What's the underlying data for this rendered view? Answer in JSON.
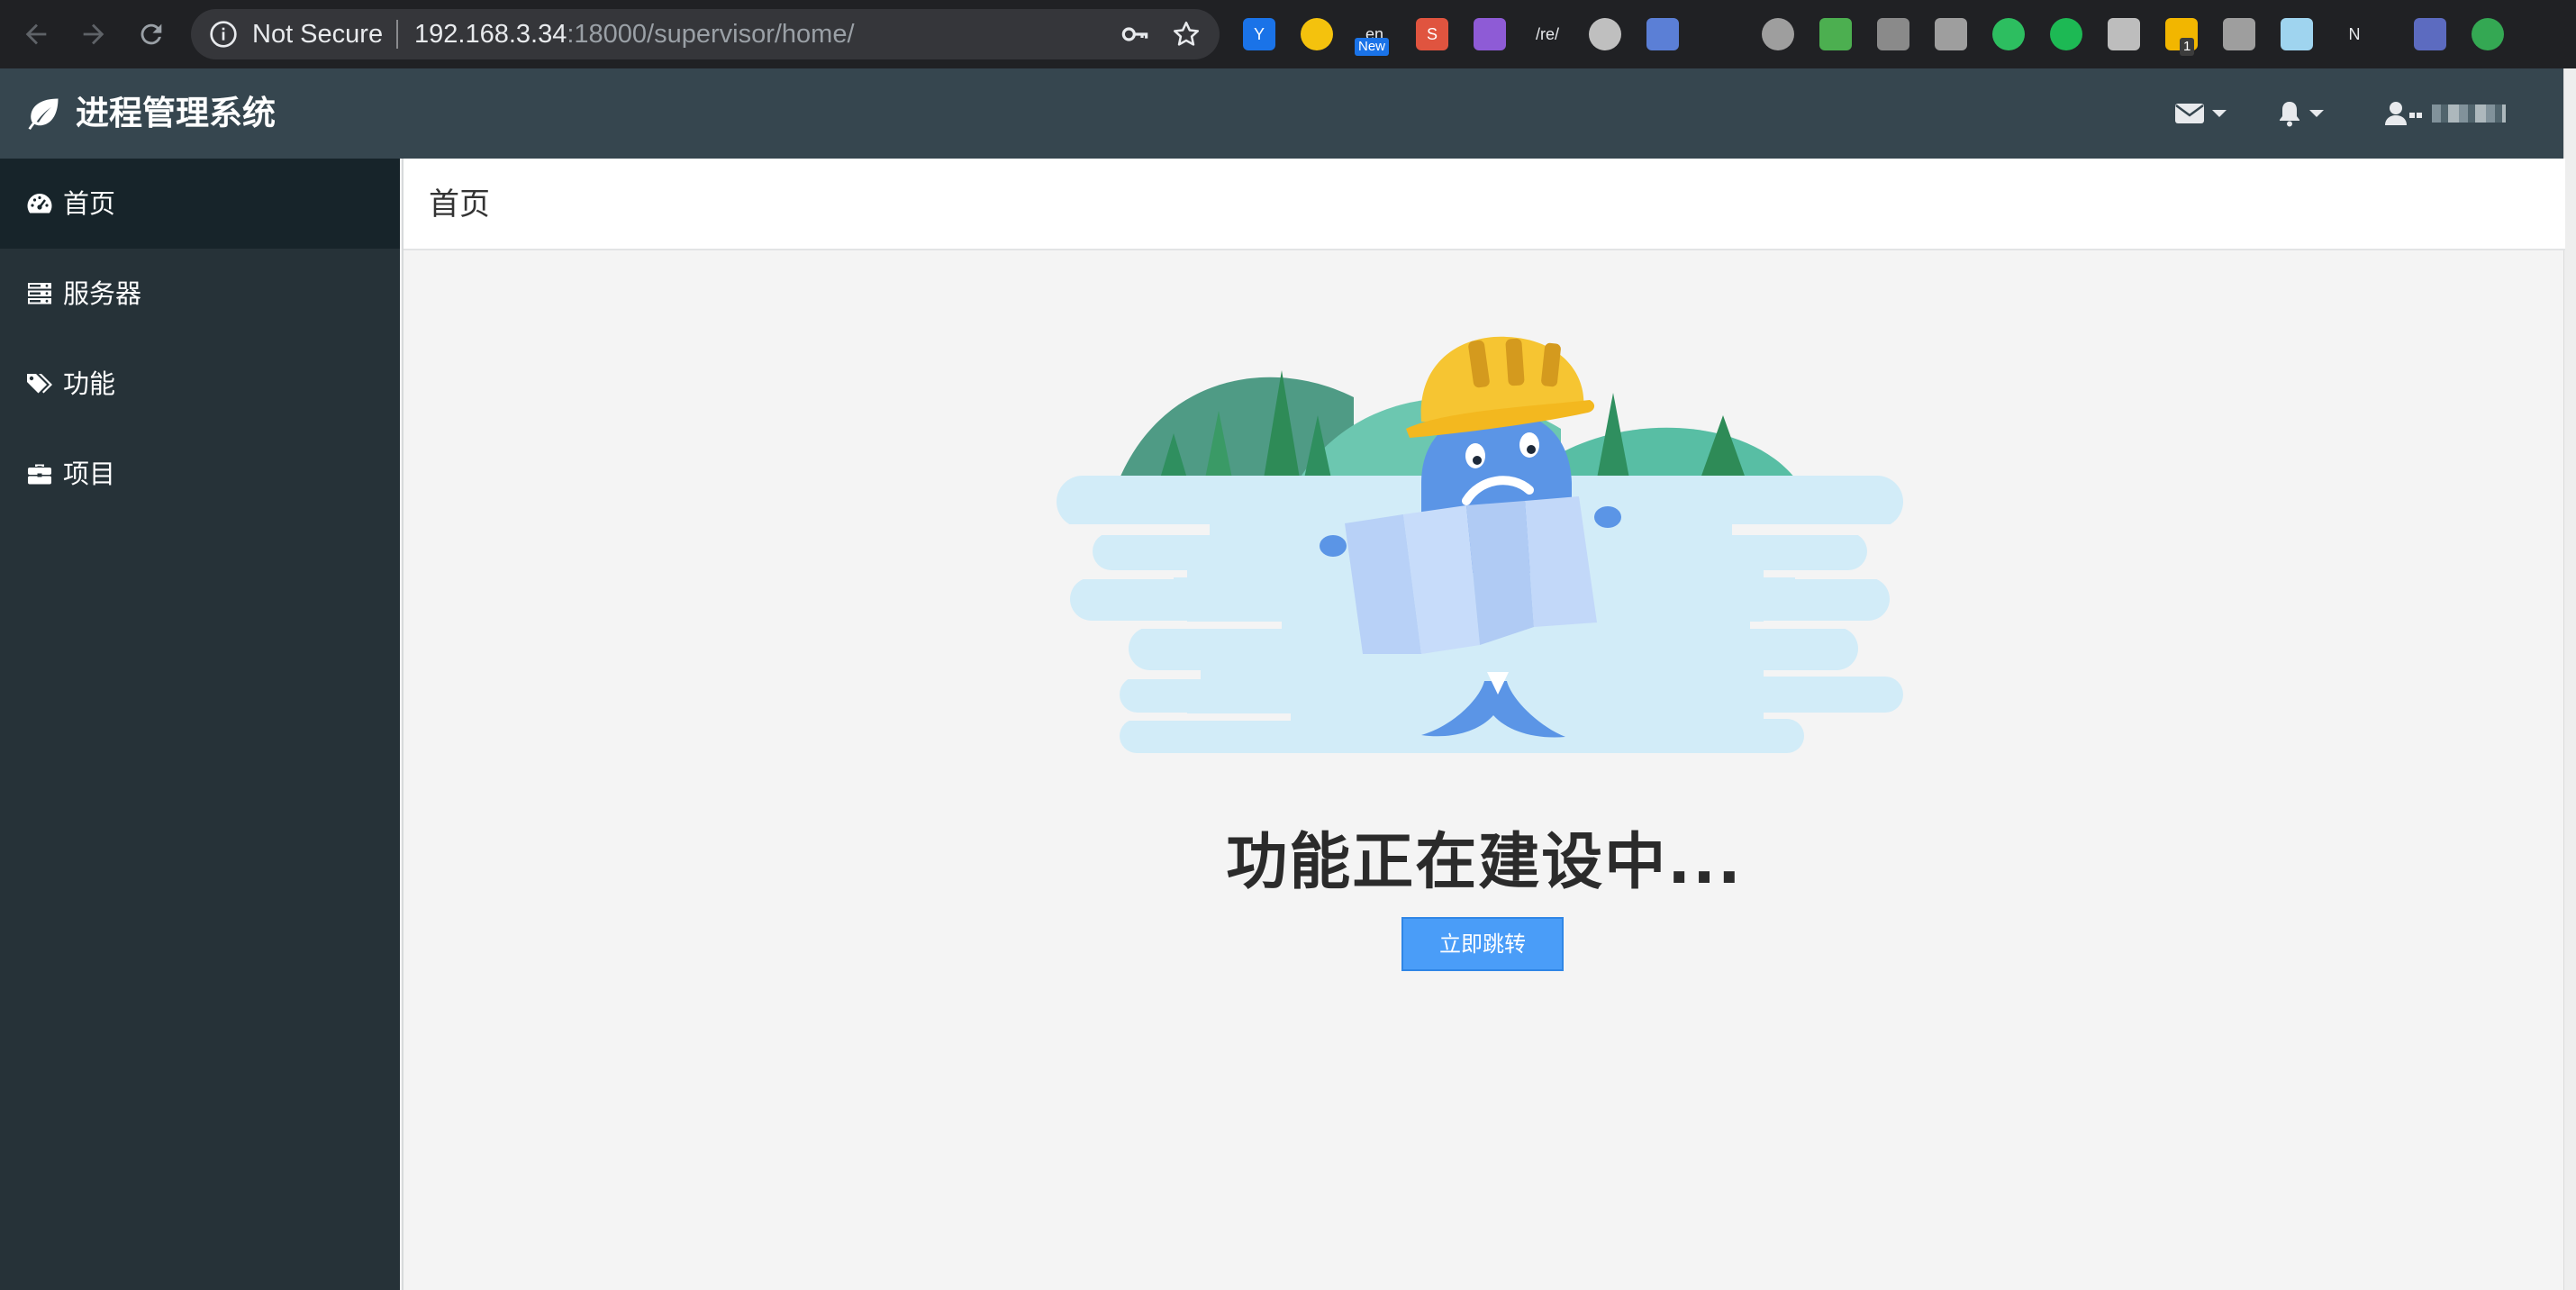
{
  "browser": {
    "security_label": "Not Secure",
    "url_host": "192.168.3.34",
    "url_path": ":18000/supervisor/home/",
    "extensions": [
      {
        "name": "y-extension-icon",
        "color": "#1a73e8",
        "glyph": "Y"
      },
      {
        "name": "smiley-extension-icon",
        "color": "#f4c20d",
        "glyph": ""
      },
      {
        "name": "translate-extension-icon",
        "color": "#ffffff",
        "glyph": "en",
        "badge": "New"
      },
      {
        "name": "s-extension-icon",
        "color": "#e0543f",
        "glyph": "S"
      },
      {
        "name": "grid-extension-icon",
        "color": "#8e5bd6",
        "glyph": ""
      },
      {
        "name": "regex-extension-icon",
        "color": "#ffffff",
        "glyph": "/re/"
      },
      {
        "name": "circle-extension-icon",
        "color": "#bfbfbf",
        "glyph": ""
      },
      {
        "name": "window-extension-icon",
        "color": "#5b7fd6",
        "glyph": ""
      },
      {
        "name": "ski-extension-icon",
        "color": "#ffffff",
        "glyph": ""
      },
      {
        "name": "ring-extension-icon",
        "color": "#9e9e9e",
        "glyph": ""
      },
      {
        "name": "apps-extension-icon",
        "color": "#4caf50",
        "glyph": ""
      },
      {
        "name": "vue-extension-icon",
        "color": "#8a8a8a",
        "glyph": ""
      },
      {
        "name": "monitor-extension-icon",
        "color": "#9e9e9e",
        "glyph": ""
      },
      {
        "name": "evernote-extension-icon",
        "color": "#2dbe60",
        "glyph": ""
      },
      {
        "name": "audio-extension-icon",
        "color": "#1db954",
        "glyph": ""
      },
      {
        "name": "dots-extension-icon",
        "color": "#bdbdbd",
        "glyph": ""
      },
      {
        "name": "note-extension-icon",
        "color": "#f2b600",
        "glyph": "",
        "badge": "1"
      },
      {
        "name": "drive-extension-icon",
        "color": "#9e9e9e",
        "glyph": ""
      },
      {
        "name": "cloud-extension-icon",
        "color": "#9fd4ef",
        "glyph": ""
      },
      {
        "name": "notion-extension-icon",
        "color": "#ffffff",
        "glyph": "N"
      },
      {
        "name": "profile-extension-icon",
        "color": "#5c6bc0",
        "glyph": ""
      },
      {
        "name": "update-extension-icon",
        "color": "#34a853",
        "glyph": ""
      }
    ]
  },
  "app": {
    "title": "进程管理系统"
  },
  "sidebar": {
    "items": [
      {
        "label": "首页",
        "icon": "dashboard-icon",
        "active": true
      },
      {
        "label": "服务器",
        "icon": "server-icon",
        "active": false
      },
      {
        "label": "功能",
        "icon": "tags-icon",
        "active": false
      },
      {
        "label": "项目",
        "icon": "briefcase-icon",
        "active": false
      }
    ]
  },
  "main": {
    "page_title": "首页",
    "heading": "功能正在建设中...",
    "button_label": "立即跳转"
  },
  "colors": {
    "header_bg": "#36464f",
    "sidebar_bg": "#263238",
    "sidebar_active_bg": "#17242a",
    "button_bg": "#4a9df8",
    "page_bg": "#f4f4f4"
  }
}
